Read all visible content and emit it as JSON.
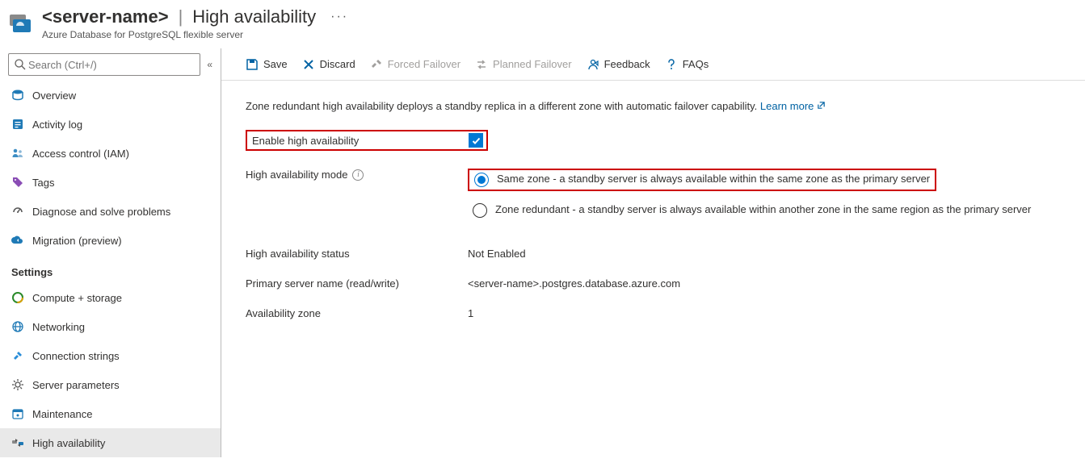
{
  "header": {
    "server_name": "<server-name>",
    "page_title": "High availability",
    "resource_type": "Azure Database for PostgreSQL flexible server",
    "more": "···"
  },
  "search": {
    "placeholder": "Search (Ctrl+/)",
    "collapse": "«"
  },
  "sidebar": {
    "overview": "Overview",
    "activity_log": "Activity log",
    "access_control": "Access control (IAM)",
    "tags": "Tags",
    "diagnose": "Diagnose and solve problems",
    "migration": "Migration (preview)",
    "settings_label": "Settings",
    "compute": "Compute + storage",
    "networking": "Networking",
    "connection_strings": "Connection strings",
    "server_parameters": "Server parameters",
    "maintenance": "Maintenance",
    "high_availability": "High availability"
  },
  "toolbar": {
    "save": "Save",
    "discard": "Discard",
    "forced_failover": "Forced Failover",
    "planned_failover": "Planned Failover",
    "feedback": "Feedback",
    "faqs": "FAQs"
  },
  "content": {
    "intro_text": "Zone redundant high availability deploys a standby replica in a different zone with automatic failover capability.",
    "learn_more": "Learn more",
    "enable_label": "Enable high availability",
    "ha_mode_label": "High availability mode",
    "radio_same_zone": "Same zone - a standby server is always available within the same zone as the primary server",
    "radio_zone_redundant": "Zone redundant - a standby server is always available within another zone in the same region as the primary server",
    "ha_status_label": "High availability status",
    "ha_status_value": "Not Enabled",
    "primary_server_label": "Primary server name (read/write)",
    "primary_server_value": "<server-name>.postgres.database.azure.com",
    "az_label": "Availability zone",
    "az_value": "1"
  }
}
